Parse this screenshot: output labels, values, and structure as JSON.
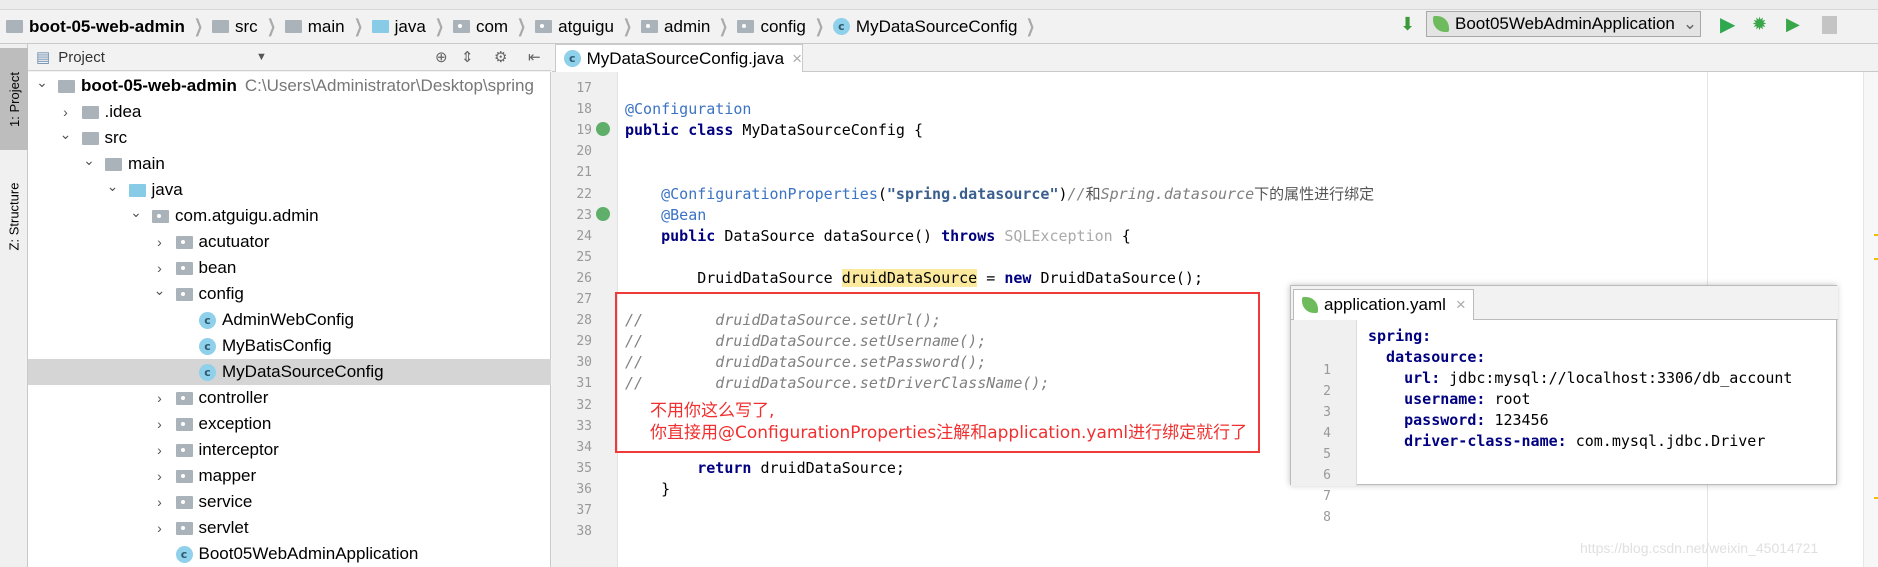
{
  "breadcrumb": [
    {
      "label": "boot-05-web-admin",
      "icon": "module-icon",
      "bold": true
    },
    {
      "label": "src",
      "icon": "folder-icon"
    },
    {
      "label": "main",
      "icon": "folder-icon"
    },
    {
      "label": "java",
      "icon": "source-folder-icon"
    },
    {
      "label": "com",
      "icon": "package-icon"
    },
    {
      "label": "atguigu",
      "icon": "package-icon"
    },
    {
      "label": "admin",
      "icon": "package-icon"
    },
    {
      "label": "config",
      "icon": "package-icon"
    },
    {
      "label": "MyDataSourceConfig",
      "icon": "class-icon"
    }
  ],
  "toolbar": {
    "run_config": "Boot05WebAdminApplication",
    "class_icon_letter": "c"
  },
  "left_stripe": {
    "project": "1: Project",
    "structure": "Z: Structure"
  },
  "project_panel": {
    "title": "Project",
    "tree": [
      {
        "label": "boot-05-web-admin",
        "path": "C:\\Users\\Administrator\\Desktop\\spring",
        "level": 0,
        "expanded": true,
        "icon": "module"
      },
      {
        "label": ".idea",
        "level": 1,
        "expanded": false,
        "icon": "folder"
      },
      {
        "label": "src",
        "level": 1,
        "expanded": true,
        "icon": "folder"
      },
      {
        "label": "main",
        "level": 2,
        "expanded": true,
        "icon": "folder"
      },
      {
        "label": "java",
        "level": 3,
        "expanded": true,
        "icon": "source"
      },
      {
        "label": "com.atguigu.admin",
        "level": 4,
        "expanded": true,
        "icon": "package"
      },
      {
        "label": "acutuator",
        "level": 5,
        "expanded": false,
        "icon": "package"
      },
      {
        "label": "bean",
        "level": 5,
        "expanded": false,
        "icon": "package"
      },
      {
        "label": "config",
        "level": 5,
        "expanded": true,
        "icon": "package"
      },
      {
        "label": "AdminWebConfig",
        "level": 6,
        "icon": "class"
      },
      {
        "label": "MyBatisConfig",
        "level": 6,
        "icon": "class"
      },
      {
        "label": "MyDataSourceConfig",
        "level": 6,
        "icon": "class",
        "selected": true
      },
      {
        "label": "controller",
        "level": 5,
        "expanded": false,
        "icon": "package"
      },
      {
        "label": "exception",
        "level": 5,
        "expanded": false,
        "icon": "package"
      },
      {
        "label": "interceptor",
        "level": 5,
        "expanded": false,
        "icon": "package"
      },
      {
        "label": "mapper",
        "level": 5,
        "expanded": false,
        "icon": "package"
      },
      {
        "label": "service",
        "level": 5,
        "expanded": false,
        "icon": "package"
      },
      {
        "label": "servlet",
        "level": 5,
        "expanded": false,
        "icon": "package"
      },
      {
        "label": "Boot05WebAdminApplication",
        "level": 5,
        "icon": "spring-class"
      }
    ]
  },
  "editor": {
    "tab": "MyDataSourceConfig.java",
    "lines": [
      {
        "n": "17",
        "tokens": []
      },
      {
        "n": "18",
        "tokens": [
          {
            "t": "@Configuration",
            "c": "ann"
          }
        ]
      },
      {
        "n": "19",
        "tokens": [
          {
            "t": "public class ",
            "c": "kw"
          },
          {
            "t": "MyDataSourceConfig {",
            "c": "plain"
          }
        ]
      },
      {
        "n": "20",
        "tokens": []
      },
      {
        "n": "21",
        "tokens": []
      },
      {
        "n": "22",
        "tokens": [
          {
            "t": "    @ConfigurationProperties",
            "c": "ann"
          },
          {
            "t": "(",
            "c": "plain"
          },
          {
            "t": "\"spring.datasource\"",
            "c": "str"
          },
          {
            "t": ")",
            "c": "plain"
          },
          {
            "t": "//",
            "c": "cmt"
          },
          {
            "t": "和",
            "c": "cmtz"
          },
          {
            "t": "Spring.datasource",
            "c": "cmt"
          },
          {
            "t": "下的属性进行绑定",
            "c": "cmtz"
          }
        ]
      },
      {
        "n": "23",
        "tokens": [
          {
            "t": "    @Bean",
            "c": "ann"
          }
        ]
      },
      {
        "n": "24",
        "tokens": [
          {
            "t": "    public ",
            "c": "kw"
          },
          {
            "t": "DataSource dataSource() ",
            "c": "plain"
          },
          {
            "t": "throws ",
            "c": "kw"
          },
          {
            "t": "SQLException ",
            "c": "gray"
          },
          {
            "t": "{",
            "c": "plain"
          }
        ]
      },
      {
        "n": "25",
        "tokens": []
      },
      {
        "n": "26",
        "tokens": [
          {
            "t": "        DruidDataSource ",
            "c": "plain"
          },
          {
            "t": "druidDataSource",
            "c": "hl"
          },
          {
            "t": " = ",
            "c": "plain"
          },
          {
            "t": "new ",
            "c": "kw"
          },
          {
            "t": "DruidDataSource();",
            "c": "plain"
          }
        ]
      },
      {
        "n": "27",
        "tokens": []
      },
      {
        "n": "28",
        "tokens": [
          {
            "t": "//        druidDataSource.setUrl();",
            "c": "cmt"
          }
        ]
      },
      {
        "n": "29",
        "tokens": [
          {
            "t": "//        druidDataSource.setUsername();",
            "c": "cmt"
          }
        ]
      },
      {
        "n": "30",
        "tokens": [
          {
            "t": "//        druidDataSource.setPassword();",
            "c": "cmt"
          }
        ]
      },
      {
        "n": "31",
        "tokens": [
          {
            "t": "//        druidDataSource.setDriverClassName();",
            "c": "cmt"
          }
        ]
      },
      {
        "n": "32",
        "tokens": []
      },
      {
        "n": "33",
        "tokens": []
      },
      {
        "n": "34",
        "tokens": []
      },
      {
        "n": "35",
        "tokens": [
          {
            "t": "        return ",
            "c": "kw"
          },
          {
            "t": "druidDataSource;",
            "c": "plain"
          }
        ]
      },
      {
        "n": "36",
        "tokens": [
          {
            "t": "    }",
            "c": "plain"
          }
        ]
      },
      {
        "n": "37",
        "tokens": []
      },
      {
        "n": "38",
        "tokens": []
      }
    ]
  },
  "annotation": {
    "line1": "不用你这么写了,",
    "line2": "你直接用@ConfigurationProperties注解和application.yaml进行绑定就行了",
    "color": "#f03a3a"
  },
  "yaml_popup": {
    "tab": "application.yaml",
    "lines": [
      {
        "n": "1",
        "tokens": [
          {
            "t": "spring:",
            "c": "ykey"
          }
        ]
      },
      {
        "n": "2",
        "tokens": [
          {
            "t": "  datasource:",
            "c": "ykey"
          }
        ]
      },
      {
        "n": "3",
        "tokens": [
          {
            "t": "    url: ",
            "c": "ykey"
          },
          {
            "t": "jdbc:mysql://localhost:3306/db_account",
            "c": "plain"
          }
        ]
      },
      {
        "n": "4",
        "tokens": [
          {
            "t": "    username: ",
            "c": "ykey"
          },
          {
            "t": "root",
            "c": "plain"
          }
        ]
      },
      {
        "n": "5",
        "tokens": [
          {
            "t": "    password: ",
            "c": "ykey"
          },
          {
            "t": "123456",
            "c": "plain"
          }
        ]
      },
      {
        "n": "6",
        "tokens": [
          {
            "t": "    driver-class-name: ",
            "c": "ykey"
          },
          {
            "t": "com.mysql.jdbc.Driver",
            "c": "plain"
          }
        ]
      },
      {
        "n": "7",
        "tokens": []
      },
      {
        "n": "8",
        "tokens": []
      }
    ]
  },
  "watermark": "https://blog.csdn.net/weixin_45014721"
}
